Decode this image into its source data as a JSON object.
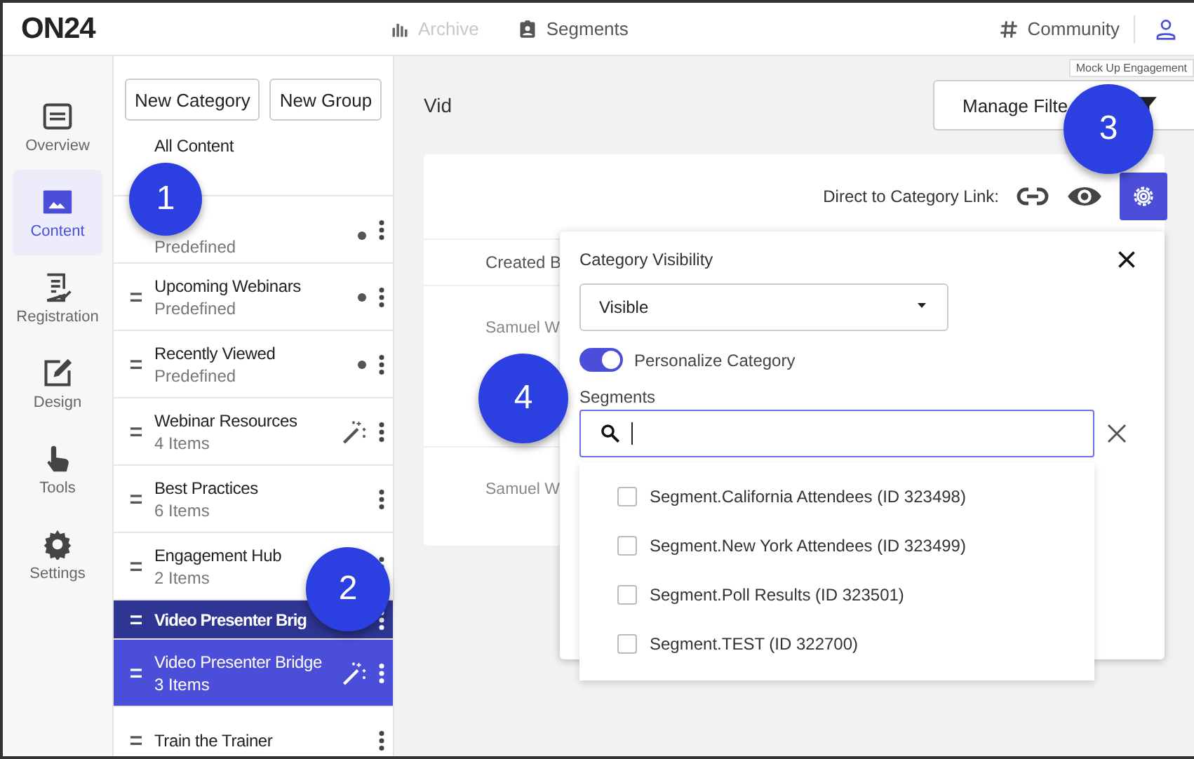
{
  "header": {
    "logo": "ON24",
    "nav": [
      {
        "label": "Archive",
        "faded": true
      },
      {
        "label": "Segments",
        "faded": false
      }
    ],
    "community": "Community",
    "tooltip": "Mock Up Engagement"
  },
  "sidebar": {
    "items": [
      {
        "label": "Overview",
        "selected": false
      },
      {
        "label": "Content",
        "selected": true
      },
      {
        "label": "Registration",
        "selected": false
      },
      {
        "label": "Design",
        "selected": false
      },
      {
        "label": "Tools",
        "selected": false
      },
      {
        "label": "Settings",
        "selected": false
      }
    ]
  },
  "categories": {
    "buttons": [
      "New Category",
      "New Group"
    ],
    "items": [
      {
        "kind": "all",
        "title": "All Content",
        "selected": false
      },
      {
        "kind": "predefined",
        "subtitle": "Predefined",
        "selected": false
      },
      {
        "kind": "predefined",
        "title": "Upcoming Webinars",
        "subtitle": "Predefined",
        "selected": false
      },
      {
        "kind": "predefined",
        "title": "Recently Viewed",
        "subtitle": "Predefined",
        "selected": false
      },
      {
        "kind": "smart",
        "title": "Webinar Resources",
        "subtitle": "4 Items",
        "selected": false
      },
      {
        "kind": "plain",
        "title": "Best Practices",
        "subtitle": "6 Items",
        "selected": false
      },
      {
        "kind": "plain",
        "title": "Engagement Hub",
        "subtitle": "2 Items",
        "selected": false
      },
      {
        "kind": "ghost",
        "title": "Video Presenter Brig",
        "selected": false
      },
      {
        "kind": "smart",
        "title": "Video Presenter Bridge",
        "subtitle": "3 Items",
        "selected": true
      },
      {
        "kind": "plain",
        "title": "Train the Trainer",
        "selected": false
      }
    ]
  },
  "main": {
    "title": "Vid",
    "manage_filters": "Manage Filte",
    "link_label": "Direct to Category Link:",
    "table": {
      "header": "Created B",
      "rows": [
        "Samuel W",
        "Samuel W"
      ]
    }
  },
  "popup": {
    "title": "Category Visibility",
    "visibility": "Visible",
    "personalize": {
      "label": "Personalize Category",
      "on": true
    },
    "segments_label": "Segments",
    "options": [
      {
        "label": "Segment.California Attendees (ID 323498)",
        "checked": false
      },
      {
        "label": "Segment.New York Attendees (ID 323499)",
        "checked": false
      },
      {
        "label": "Segment.Poll Results (ID 323501)",
        "checked": false
      },
      {
        "label": "Segment.TEST (ID 322700)",
        "checked": false
      }
    ]
  },
  "callouts": [
    "1",
    "2",
    "3",
    "4"
  ]
}
